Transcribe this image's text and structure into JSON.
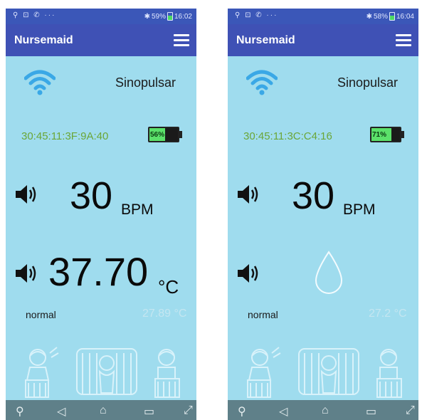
{
  "screens": [
    {
      "status_bar": {
        "icons_left": "⚲ ⊡ ✆ ···",
        "bluetooth_icon": "bluetooth-icon",
        "battery_text": "59%",
        "time": "16:02"
      },
      "app_bar": {
        "title": "Nursemaid",
        "menu_icon": "hamburger-menu-icon"
      },
      "device_name": "Sinopulsar",
      "mac_address": "30:45:11:3F:9A:40",
      "battery": {
        "label": "56%",
        "level": 0.56,
        "fill_color": "#5be16a"
      },
      "heart_rate": {
        "value": "30",
        "unit": "BPM"
      },
      "temperature": {
        "value": "37.70",
        "unit": "°C"
      },
      "status": "normal",
      "ambient_temperature": "27.89 °C"
    },
    {
      "status_bar": {
        "icons_left": "⚲ ⊡ ✆ ···",
        "bluetooth_icon": "bluetooth-icon",
        "battery_text": "58%",
        "time": "16:04"
      },
      "app_bar": {
        "title": "Nursemaid",
        "menu_icon": "hamburger-menu-icon"
      },
      "device_name": "Sinopulsar",
      "mac_address": "30:45:11:3C:C4:16",
      "battery": {
        "label": "71%",
        "level": 0.71,
        "fill_color": "#5be16a"
      },
      "heart_rate": {
        "value": "30",
        "unit": "BPM"
      },
      "temperature": {
        "placeholder_icon": "water-drop-icon"
      },
      "status": "normal",
      "ambient_temperature": "27.2 °C"
    }
  ],
  "colors": {
    "app_bar": "#3f51b5",
    "status_bar": "#3b57b8",
    "background": "#9fdcee",
    "mac_text": "#6ba637",
    "wifi": "#3aa8e6"
  }
}
